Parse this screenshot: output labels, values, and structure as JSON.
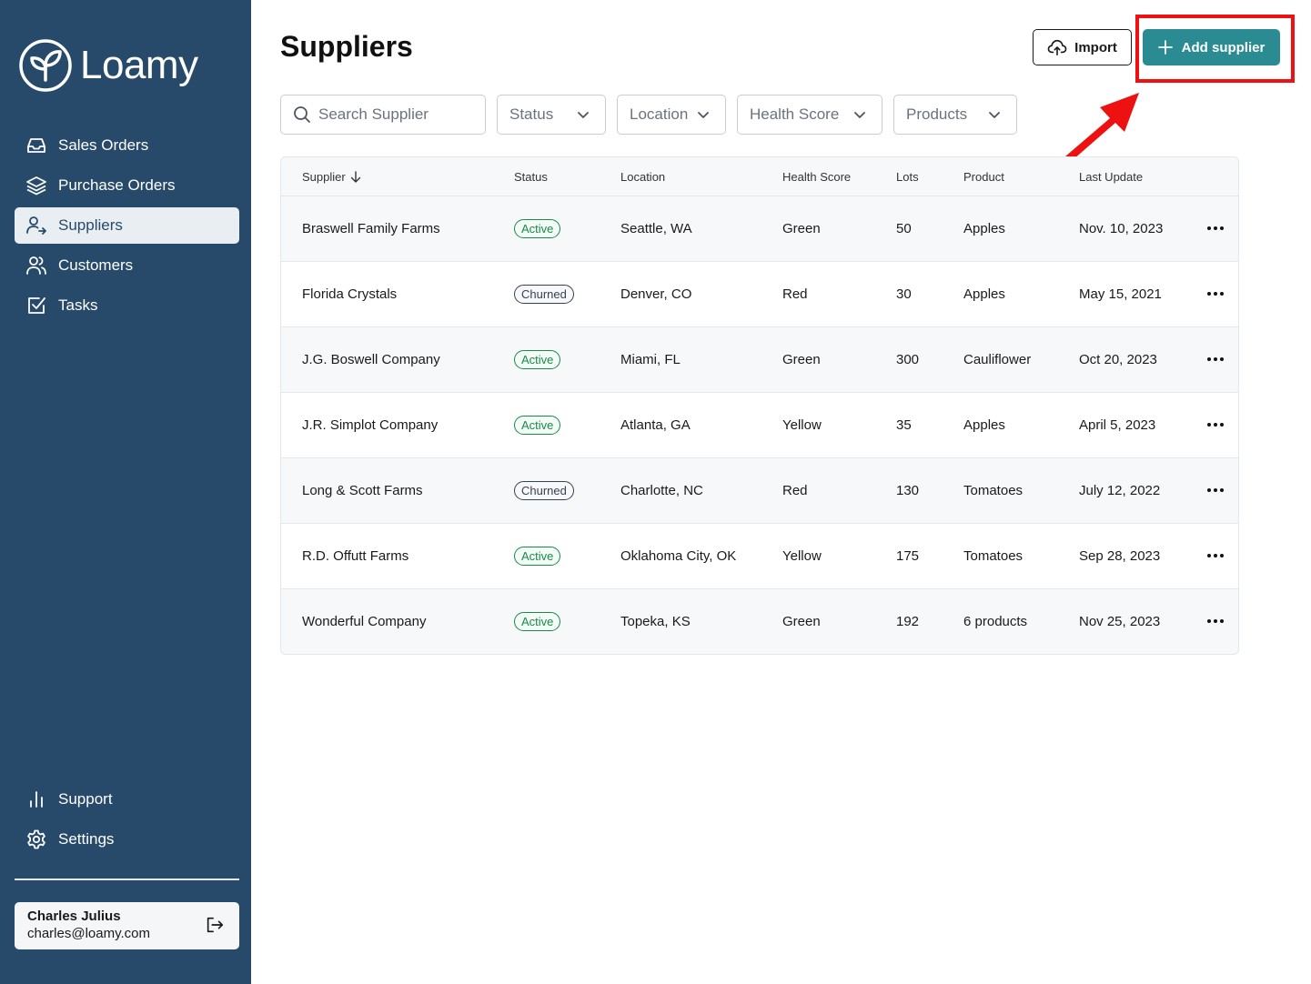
{
  "brand": {
    "name": "Loamy"
  },
  "sidebar": {
    "items": [
      {
        "label": "Sales Orders",
        "icon": "inbox-icon",
        "active": false
      },
      {
        "label": "Purchase Orders",
        "icon": "layers-icon",
        "active": false
      },
      {
        "label": "Suppliers",
        "icon": "user-arrow-icon",
        "active": true
      },
      {
        "label": "Customers",
        "icon": "users-icon",
        "active": false
      },
      {
        "label": "Tasks",
        "icon": "checkbox-icon",
        "active": false
      }
    ],
    "bottom_items": [
      {
        "label": "Support",
        "icon": "bar-chart-icon"
      },
      {
        "label": "Settings",
        "icon": "gear-icon"
      }
    ],
    "user": {
      "name": "Charles Julius",
      "email": "charles@loamy.com"
    }
  },
  "header": {
    "title": "Suppliers",
    "import_label": "Import",
    "add_label": "Add supplier"
  },
  "filters": {
    "search_placeholder": "Search Supplier",
    "status": "Status",
    "location": "Location",
    "health_score": "Health Score",
    "products": "Products"
  },
  "table": {
    "columns": [
      "Supplier",
      "Status",
      "Location",
      "Health Score",
      "Lots",
      "Product",
      "Last Update"
    ],
    "rows": [
      {
        "supplier": "Braswell Family Farms",
        "status": "Active",
        "location": "Seattle, WA",
        "health": "Green",
        "lots": "50",
        "product": "Apples",
        "updated": "Nov. 10, 2023"
      },
      {
        "supplier": "Florida Crystals",
        "status": "Churned",
        "location": "Denver, CO",
        "health": "Red",
        "lots": "30",
        "product": "Apples",
        "updated": "May 15, 2021"
      },
      {
        "supplier": "J.G. Boswell Company",
        "status": "Active",
        "location": "Miami, FL",
        "health": "Green",
        "lots": "300",
        "product": "Cauliflower",
        "updated": "Oct 20, 2023"
      },
      {
        "supplier": "J.R. Simplot Company",
        "status": "Active",
        "location": "Atlanta, GA",
        "health": "Yellow",
        "lots": "35",
        "product": "Apples",
        "updated": "April 5, 2023"
      },
      {
        "supplier": "Long & Scott Farms",
        "status": "Churned",
        "location": "Charlotte, NC",
        "health": "Red",
        "lots": "130",
        "product": "Tomatoes",
        "updated": "July 12, 2022"
      },
      {
        "supplier": "R.D. Offutt Farms",
        "status": "Active",
        "location": "Oklahoma City, OK",
        "health": "Yellow",
        "lots": "175",
        "product": "Tomatoes",
        "updated": "Sep 28, 2023"
      },
      {
        "supplier": "Wonderful Company",
        "status": "Active",
        "location": "Topeka, KS",
        "health": "Green",
        "lots": "192",
        "product": "6 products",
        "updated": "Nov 25, 2023"
      }
    ]
  },
  "colors": {
    "sidebar": "#274a6a",
    "accent": "#2a8c92",
    "highlight": "#ee1111",
    "active_badge": "#1a8a4a"
  }
}
